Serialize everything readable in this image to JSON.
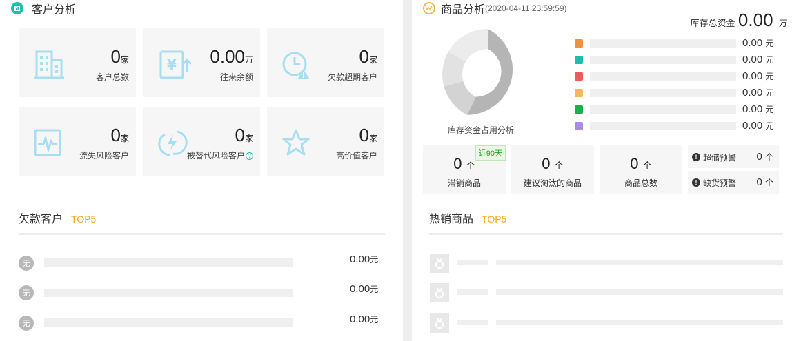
{
  "customer_analysis": {
    "title": "客户分析",
    "cards": [
      {
        "value": "0",
        "unit": "家",
        "label": "客户总数",
        "icon": "building-icon"
      },
      {
        "value": "0.00",
        "unit": "万",
        "label": "往来余额",
        "icon": "yuan-ledger-icon"
      },
      {
        "value": "0",
        "unit": "家",
        "label": "欠款超期客户",
        "icon": "clock-warning-icon"
      },
      {
        "value": "0",
        "unit": "家",
        "label": "流失风险客户",
        "icon": "pulse-monitor-icon"
      },
      {
        "value": "0",
        "unit": "家",
        "label": "被替代风险客户",
        "icon": "lightning-circle-icon"
      },
      {
        "value": "0",
        "unit": "家",
        "label": "高价值客户",
        "icon": "star-icon"
      }
    ]
  },
  "debt_top5": {
    "title": "欠款客户",
    "tag": "TOP5",
    "rows": [
      {
        "avatar": "无",
        "value": "0.00",
        "unit": "元"
      },
      {
        "avatar": "无",
        "value": "0.00",
        "unit": "元"
      },
      {
        "avatar": "无",
        "value": "0.00",
        "unit": "元"
      }
    ]
  },
  "product_analysis": {
    "title": "商品分析",
    "timestamp": "(2020-04-11 23:59:59)",
    "stock_total_label": "库存总资金",
    "stock_total_value": "0.00",
    "stock_total_unit": "万",
    "donut_caption": "库存资金占用分析",
    "legend": [
      {
        "color": "#f5913c",
        "value": "0.00",
        "unit": "元"
      },
      {
        "color": "#1bbfae",
        "value": "0.00",
        "unit": "元"
      },
      {
        "color": "#f15a5a",
        "value": "0.00",
        "unit": "元"
      },
      {
        "color": "#f6b85a",
        "value": "0.00",
        "unit": "元"
      },
      {
        "color": "#18b24b",
        "value": "0.00",
        "unit": "元"
      },
      {
        "color": "#a98bea",
        "value": "0.00",
        "unit": "元"
      }
    ],
    "stats": [
      {
        "value": "0",
        "unit": "个",
        "label": "滞销商品",
        "badge": "近90天"
      },
      {
        "value": "0",
        "unit": "个",
        "label": "建议淘汰的商品"
      },
      {
        "value": "0",
        "unit": "个",
        "label": "商品总数"
      }
    ],
    "warnings": [
      {
        "label": "超储预警",
        "value": "0",
        "unit": "个"
      },
      {
        "label": "缺货预警",
        "value": "0",
        "unit": "个"
      }
    ]
  },
  "hot_top5": {
    "title": "热销商品",
    "tag": "TOP5"
  },
  "colors": {
    "accent_teal": "#1bbfae",
    "icon_blue": "#a8def2",
    "top_tag": "#f0a818",
    "trend_icon": "#f5b44a"
  }
}
